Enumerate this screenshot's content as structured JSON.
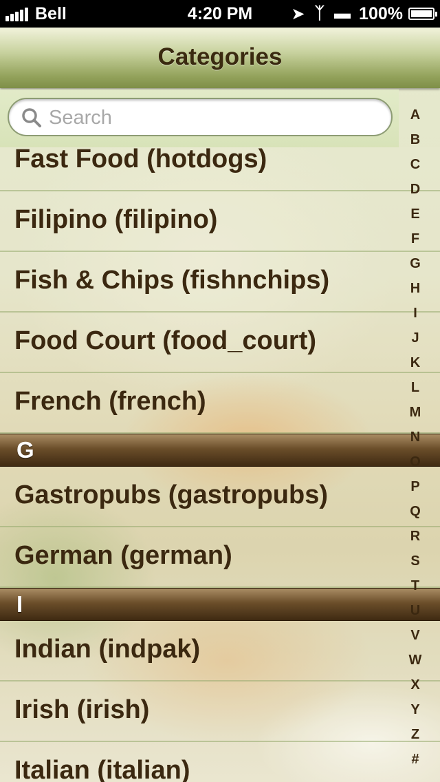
{
  "status_bar": {
    "carrier": "Bell",
    "time": "4:20 PM",
    "battery": "100%"
  },
  "nav": {
    "title": "Categories"
  },
  "search": {
    "placeholder": "Search",
    "value": ""
  },
  "rows": [
    {
      "type": "item",
      "label": "Fast Food (hotdogs)"
    },
    {
      "type": "item",
      "label": "Filipino (filipino)"
    },
    {
      "type": "item",
      "label": "Fish & Chips (fishnchips)"
    },
    {
      "type": "item",
      "label": "Food Court (food_court)"
    },
    {
      "type": "item",
      "label": "French (french)"
    },
    {
      "type": "section",
      "label": "G"
    },
    {
      "type": "item",
      "label": "Gastropubs (gastropubs)"
    },
    {
      "type": "item",
      "label": "German (german)"
    },
    {
      "type": "section",
      "label": "I"
    },
    {
      "type": "item",
      "label": "Indian (indpak)"
    },
    {
      "type": "item",
      "label": "Irish (irish)"
    },
    {
      "type": "item",
      "label": "Italian (italian)"
    }
  ],
  "index_letters": [
    "A",
    "B",
    "C",
    "D",
    "E",
    "F",
    "G",
    "H",
    "I",
    "J",
    "K",
    "L",
    "M",
    "N",
    "O",
    "P",
    "Q",
    "R",
    "S",
    "T",
    "U",
    "V",
    "W",
    "X",
    "Y",
    "Z",
    "#"
  ],
  "colors": {
    "text_brown": "#3b2810",
    "section_bar": "#6b4e2a",
    "nav_green": "#94a35c"
  }
}
